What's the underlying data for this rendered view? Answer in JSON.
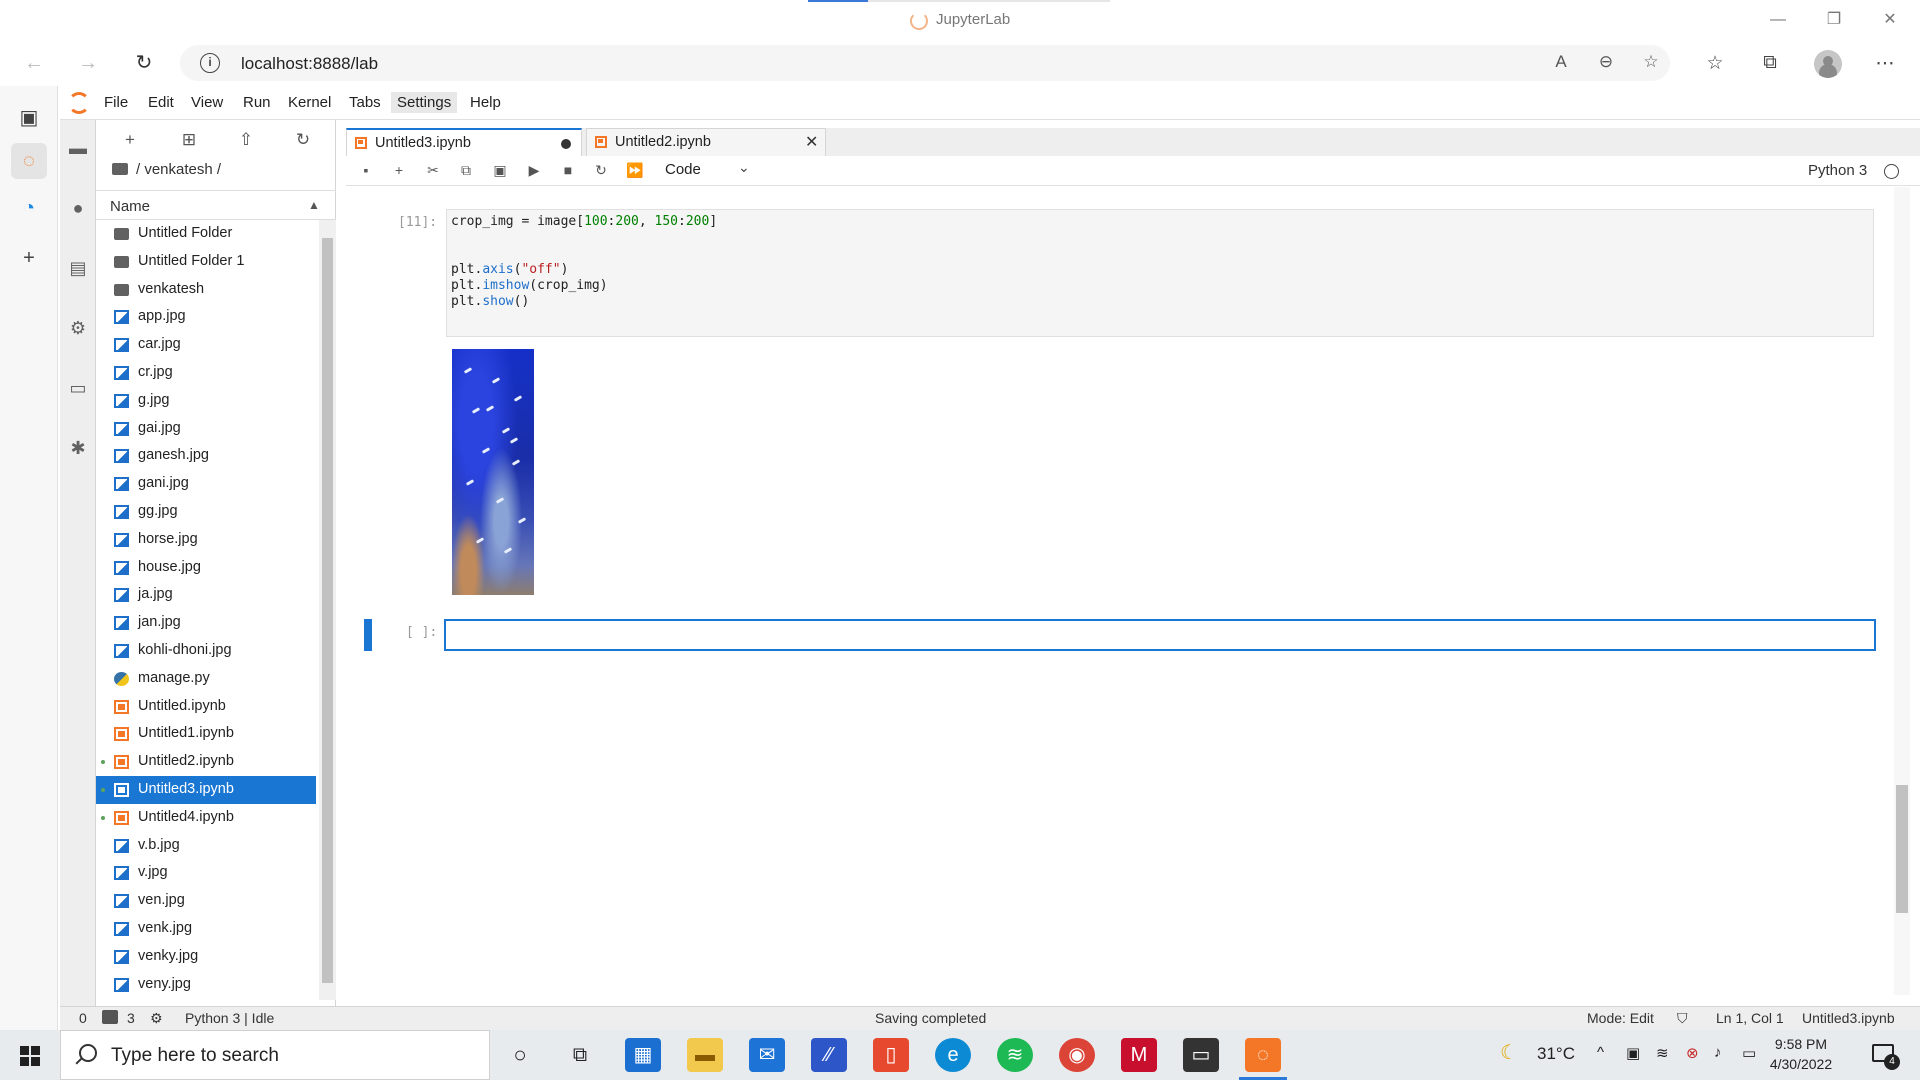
{
  "browser": {
    "title": "JupyterLab",
    "url": "localhost:8888/lab",
    "controls": {
      "minimize": "—",
      "restore": "❐",
      "close": "✕"
    }
  },
  "jupyter": {
    "menu": [
      "File",
      "Edit",
      "View",
      "Run",
      "Kernel",
      "Tabs",
      "Settings",
      "Help"
    ],
    "breadcrumb": "/ venkatesh /",
    "list_header": "Name",
    "files": [
      {
        "name": "Untitled Folder",
        "type": "folder"
      },
      {
        "name": "Untitled Folder 1",
        "type": "folder"
      },
      {
        "name": "venkatesh",
        "type": "folder"
      },
      {
        "name": "app.jpg",
        "type": "image"
      },
      {
        "name": "car.jpg",
        "type": "image"
      },
      {
        "name": "cr.jpg",
        "type": "image"
      },
      {
        "name": "g.jpg",
        "type": "image"
      },
      {
        "name": "gai.jpg",
        "type": "image"
      },
      {
        "name": "ganesh.jpg",
        "type": "image"
      },
      {
        "name": "gani.jpg",
        "type": "image"
      },
      {
        "name": "gg.jpg",
        "type": "image"
      },
      {
        "name": "horse.jpg",
        "type": "image"
      },
      {
        "name": "house.jpg",
        "type": "image"
      },
      {
        "name": "ja.jpg",
        "type": "image"
      },
      {
        "name": "jan.jpg",
        "type": "image"
      },
      {
        "name": "kohli-dhoni.jpg",
        "type": "image"
      },
      {
        "name": "manage.py",
        "type": "python"
      },
      {
        "name": "Untitled.ipynb",
        "type": "notebook"
      },
      {
        "name": "Untitled1.ipynb",
        "type": "notebook"
      },
      {
        "name": "Untitled2.ipynb",
        "type": "notebook",
        "running": true
      },
      {
        "name": "Untitled3.ipynb",
        "type": "notebook",
        "running": true,
        "selected": true
      },
      {
        "name": "Untitled4.ipynb",
        "type": "notebook",
        "running": true
      },
      {
        "name": "v.b.jpg",
        "type": "image"
      },
      {
        "name": "v.jpg",
        "type": "image"
      },
      {
        "name": "ven.jpg",
        "type": "image"
      },
      {
        "name": "venk.jpg",
        "type": "image"
      },
      {
        "name": "venky.jpg",
        "type": "image"
      },
      {
        "name": "veny.jpg",
        "type": "image"
      }
    ],
    "tabs": [
      {
        "label": "Untitled3.ipynb",
        "active": true,
        "modified": true
      },
      {
        "label": "Untitled2.ipynb",
        "active": false,
        "close": "✕"
      }
    ],
    "toolbar": {
      "cell_type": "Code",
      "kernel": "Python 3"
    },
    "cells": {
      "executed_prompt": "[11]:",
      "empty_prompt": "[ ]:",
      "code_lines": [
        [
          {
            "t": "crop_img = image["
          },
          {
            "t": "100",
            "c": "kw-num"
          },
          {
            "t": ":"
          },
          {
            "t": "200",
            "c": "kw-num"
          },
          {
            "t": ", "
          },
          {
            "t": "150",
            "c": "kw-num"
          },
          {
            "t": ":"
          },
          {
            "t": "200",
            "c": "kw-num"
          },
          {
            "t": "]"
          }
        ],
        [],
        [],
        [
          {
            "t": "plt."
          },
          {
            "t": "axis",
            "c": "kw-fn"
          },
          {
            "t": "("
          },
          {
            "t": "\"off\"",
            "c": "kw-str"
          },
          {
            "t": ")"
          }
        ],
        [
          {
            "t": "plt."
          },
          {
            "t": "imshow",
            "c": "kw-fn"
          },
          {
            "t": "(crop_img)"
          }
        ],
        [
          {
            "t": "plt."
          },
          {
            "t": "show",
            "c": "kw-fn"
          },
          {
            "t": "()"
          }
        ]
      ]
    },
    "status": {
      "left_count": "0",
      "terminals": "3",
      "kernel": "Python 3 | Idle",
      "message": "Saving completed",
      "mode": "Mode: Edit",
      "position": "Ln 1, Col 1",
      "file": "Untitled3.ipynb"
    }
  },
  "taskbar": {
    "search_placeholder": "Type here to search",
    "weather": "31°C",
    "time": "9:58 PM",
    "date": "4/30/2022",
    "notifications": "4"
  },
  "colors": {
    "jupyter_brand": "#f37726",
    "selection": "#1976d2"
  }
}
